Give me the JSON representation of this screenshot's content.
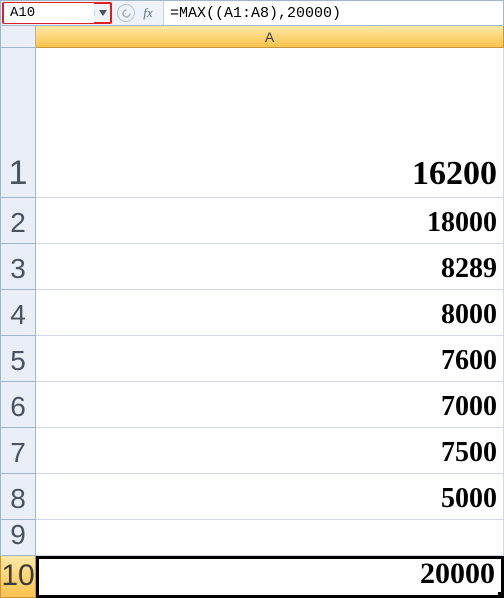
{
  "name_box": "A10",
  "fx_label": "fx",
  "formula": "=MAX((A1:A8),20000)",
  "column_header": "A",
  "rows": [
    {
      "n": "1",
      "val": "16200"
    },
    {
      "n": "2",
      "val": "18000"
    },
    {
      "n": "3",
      "val": "8289"
    },
    {
      "n": "4",
      "val": "8000"
    },
    {
      "n": "5",
      "val": "7600"
    },
    {
      "n": "6",
      "val": "7000"
    },
    {
      "n": "7",
      "val": "7500"
    },
    {
      "n": "8",
      "val": "5000"
    },
    {
      "n": "9",
      "val": ""
    },
    {
      "n": "10",
      "val": "20000"
    }
  ],
  "selected_row": "10"
}
